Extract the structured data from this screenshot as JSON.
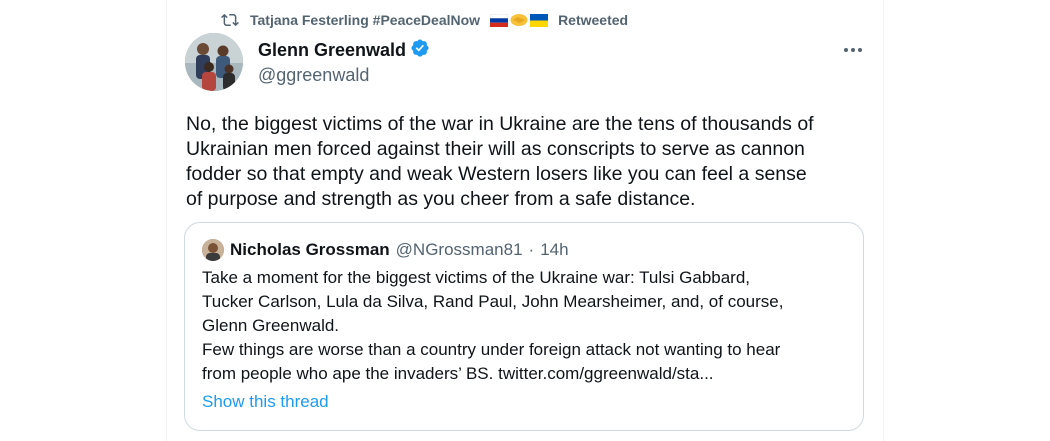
{
  "retweet": {
    "user": "Tatjana Festerling #PeaceDealNow",
    "emoji": "🇷🇺 🤝 🇺🇦",
    "suffix": "Retweeted"
  },
  "tweet": {
    "author_name": "Glenn Greenwald",
    "author_handle": "@ggreenwald",
    "verified": true,
    "text_lines": [
      "No, the biggest victims of the war in Ukraine are the tens of thousands of",
      "Ukrainian men forced against their will as conscripts to serve as cannon",
      "fodder so that empty and weak Western losers like you can feel a sense",
      "of purpose and strength as you cheer from a safe distance."
    ]
  },
  "quote": {
    "author_name": "Nicholas Grossman",
    "author_handle": "@NGrossman81",
    "separator": "·",
    "time": "14h",
    "text_lines": [
      "Take a moment for the biggest victims of the Ukraine war: Tulsi Gabbard,",
      "Tucker Carlson, Lula da Silva, Rand Paul, John Mearsheimer, and, of course,",
      "Glenn Greenwald.",
      "Few things are worse than a country under foreign attack not wanting to hear",
      "from people who ape the invaders’ BS. twitter.com/ggreenwald/sta..."
    ],
    "show_thread": "Show this thread"
  },
  "icons": {
    "retweet": "retweet-icon",
    "verified": "verified-badge-icon",
    "more": "more-options-icon"
  },
  "colors": {
    "accent": "#1d9bf0",
    "secondary_text": "#536471",
    "primary_text": "#0f1419",
    "border": "#cfd9de"
  }
}
